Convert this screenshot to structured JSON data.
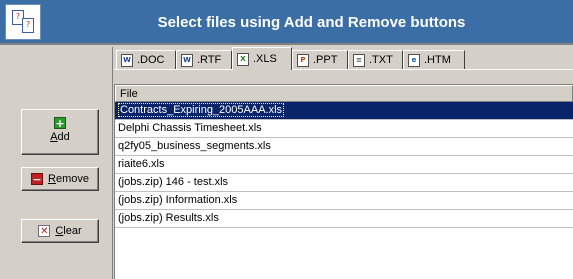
{
  "header": {
    "title": "Select files using Add and Remove buttons"
  },
  "buttons": {
    "add": {
      "pre": "",
      "accel": "A",
      "post": "dd"
    },
    "remove": {
      "pre": "",
      "accel": "R",
      "post": "emove"
    },
    "clear": {
      "pre": "",
      "accel": "C",
      "post": "lear"
    }
  },
  "tabs": [
    {
      "label": ".DOC",
      "icon": "word-doc-icon"
    },
    {
      "label": ".RTF",
      "icon": "word-rtf-icon"
    },
    {
      "label": ".XLS",
      "icon": "excel-icon",
      "active": true
    },
    {
      "label": ".PPT",
      "icon": "powerpoint-icon"
    },
    {
      "label": ".TXT",
      "icon": "text-file-icon"
    },
    {
      "label": ".HTM",
      "icon": "html-icon"
    }
  ],
  "filelist": {
    "column_header": "File",
    "selected_index": 0,
    "rows": [
      "Contracts_Expiring_2005AAA.xls",
      "Delphi Chassis Timesheet.xls",
      "q2fy05_business_segments.xls",
      "riaite6.xls",
      "(jobs.zip) 146 - test.xls",
      "(jobs.zip) Information.xls",
      "(jobs.zip) Results.xls"
    ]
  },
  "colors": {
    "header_bg": "#3a6ea5",
    "panel_bg": "#d4d0c8",
    "selection_bg": "#0a246a"
  }
}
